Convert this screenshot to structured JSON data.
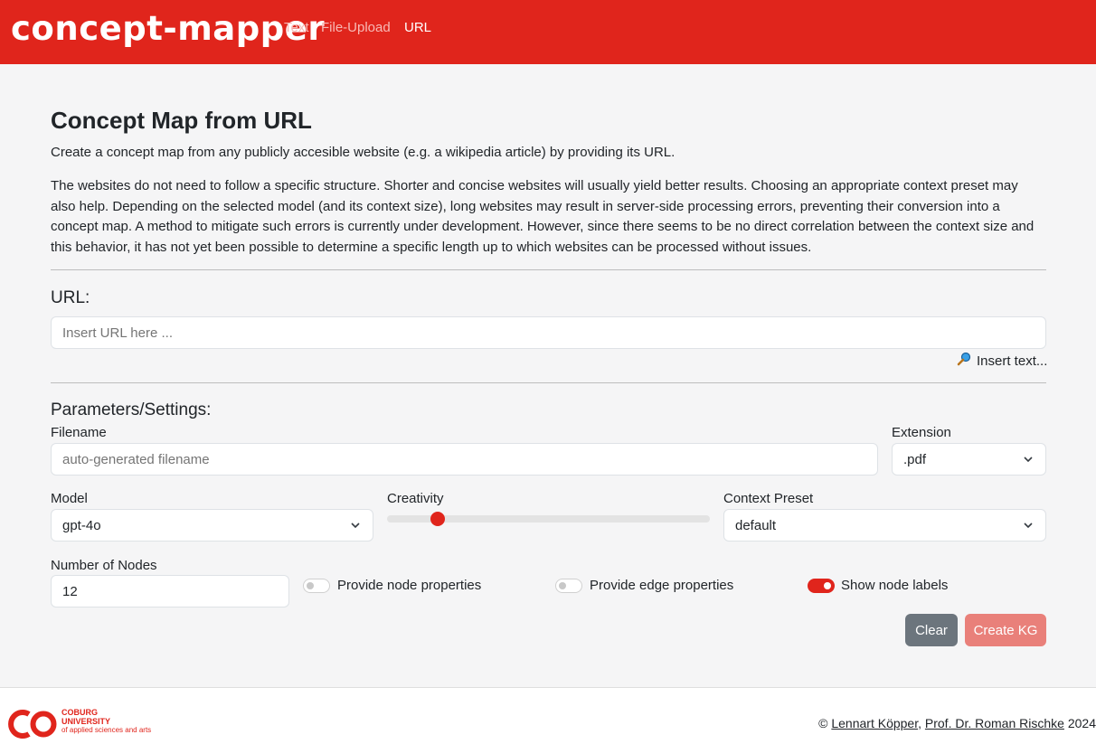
{
  "nav": {
    "brand": "concept-mapper",
    "links": [
      "Text",
      "File-Upload",
      "URL"
    ]
  },
  "page": {
    "title": "Concept Map from URL",
    "lead": "Create a concept map from any publicly accesible website (e.g. a wikipedia article) by providing its URL.",
    "description": "The websites do not need to follow a specific structure. Shorter and concise websites will usually yield better results. Choosing an appropriate context preset may also help. Depending on the selected model (and its context size), long websites may result in server-side processing errors, preventing their conversion into a concept map. A method to mitigate such errors is currently under development. However, since there seems to be no direct correlation between the context size and this behavior, it has not yet been possible to determine a specific length up to which websites can be processed without issues."
  },
  "url_section": {
    "label": "URL:",
    "placeholder": "Insert URL here ...",
    "value": "",
    "insert_text_link": "Insert text..."
  },
  "settings": {
    "heading": "Parameters/Settings:",
    "filename_label": "Filename",
    "filename_placeholder": "auto-generated filename",
    "extension_label": "Extension",
    "extension_value": ".pdf",
    "model_label": "Model",
    "model_value": "gpt-4o",
    "creativity_label": "Creativity",
    "creativity_value": 0.14,
    "context_label": "Context Preset",
    "context_value": "default",
    "nodes_label": "Number of Nodes",
    "nodes_value": "12",
    "toggles": [
      {
        "label": "Provide node properties",
        "on": false
      },
      {
        "label": "Provide edge properties",
        "on": false
      },
      {
        "label": "Show node labels",
        "on": true
      }
    ]
  },
  "buttons": {
    "clear": "Clear",
    "create": "Create KG"
  },
  "footer": {
    "university_line1": "COBURG",
    "university_line2": "UNIVERSITY",
    "university_line3": "of applied sciences and arts",
    "copyright_symbol": "©",
    "author1": "Lennart Köpper",
    "separator": ",",
    "author2": "Prof. Dr. Roman Rischke",
    "year": "2024"
  },
  "colors": {
    "brand": "#e0251c",
    "secondary": "#6c757d",
    "create_disabled": "#e9807a"
  }
}
